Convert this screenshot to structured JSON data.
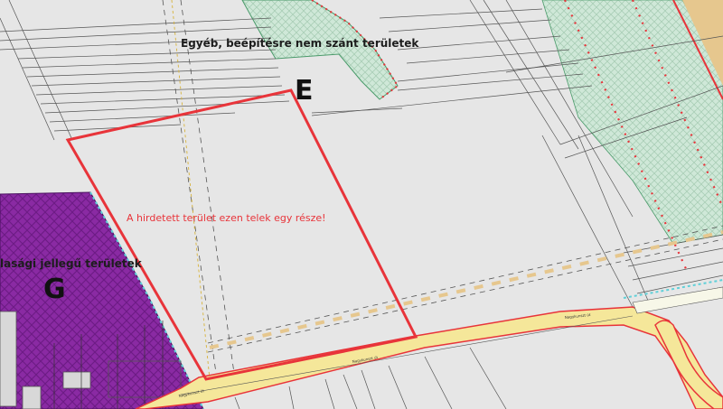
{
  "map": {
    "labels": {
      "zone_e_text": "Egyéb, beépítésre nem szánt területek",
      "zone_e_letter": "E",
      "zone_g_text": "lasági jellegű területek",
      "zone_g_letter": "G",
      "parcel_note": "A hirdetett terület ezen telek egy része!",
      "road_label_1": "Nagykunszt út",
      "road_label_2": "Nagykunszt út",
      "road_label_3": "Nagykunszt út"
    },
    "colors": {
      "background": "#e6e6e6",
      "green_zone": "#cfe8d8",
      "purple_zone": "#8a2aa3",
      "road_fill": "#f5e79a",
      "highlight_red": "#e8343a",
      "tan_strip": "#e6c78e",
      "dots_red": "#e8343a",
      "cyan_edge": "#5fd0d8"
    }
  }
}
